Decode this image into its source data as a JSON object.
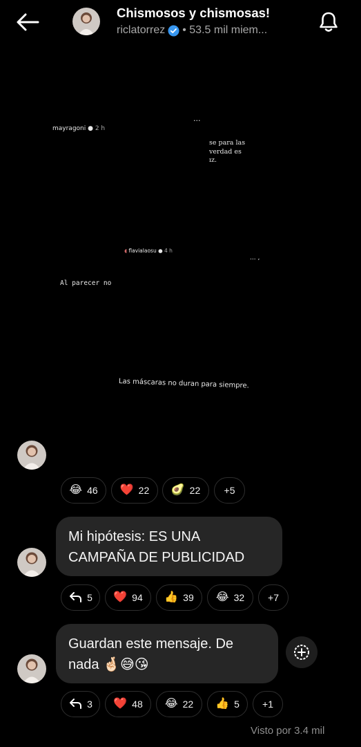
{
  "header": {
    "back_icon": "arrow-left-icon",
    "title": "Chismosos y chismosas!",
    "owner": "riclatorrez",
    "members": "• 53.5 mil miem...",
    "bell_icon": "bell-icon"
  },
  "story": {
    "user1": "mayragoni",
    "time1": "2 h",
    "dots1": "...",
    "text1_line1": "se para las",
    "text1_line2": "verdad es",
    "text1_line3": "ız.",
    "user2": "flavialaosu",
    "time2": "4 h",
    "dots2": "... ,",
    "text2": "Al parecer no",
    "text3": "Las máscaras no duran para siempre."
  },
  "reactions1": [
    {
      "emoji": "😂",
      "count": "46"
    },
    {
      "emoji": "❤️",
      "count": "22"
    },
    {
      "emoji": "🥑",
      "count": "22"
    },
    {
      "emoji": "",
      "count": "+5"
    }
  ],
  "message1": {
    "line1": "Mi hipótesis: ES UNA",
    "line2": "CAMPAÑA DE PUBLICIDAD"
  },
  "reactions2": [
    {
      "emoji": "↩",
      "count": "5"
    },
    {
      "emoji": "❤️",
      "count": "94"
    },
    {
      "emoji": "👍",
      "count": "39"
    },
    {
      "emoji": "😂",
      "count": "32"
    },
    {
      "emoji": "",
      "count": "+7"
    }
  ],
  "message2": {
    "line1": "Guardan este mensaje. De",
    "line2": "nada 🤞🏻😅😘"
  },
  "reactions3": [
    {
      "emoji": "↩",
      "count": "3"
    },
    {
      "emoji": "❤️",
      "count": "48"
    },
    {
      "emoji": "😂",
      "count": "22"
    },
    {
      "emoji": "👍",
      "count": "5"
    },
    {
      "emoji": "",
      "count": "+1"
    }
  ],
  "footer": {
    "seen": "Visto por 3.4 mil"
  }
}
